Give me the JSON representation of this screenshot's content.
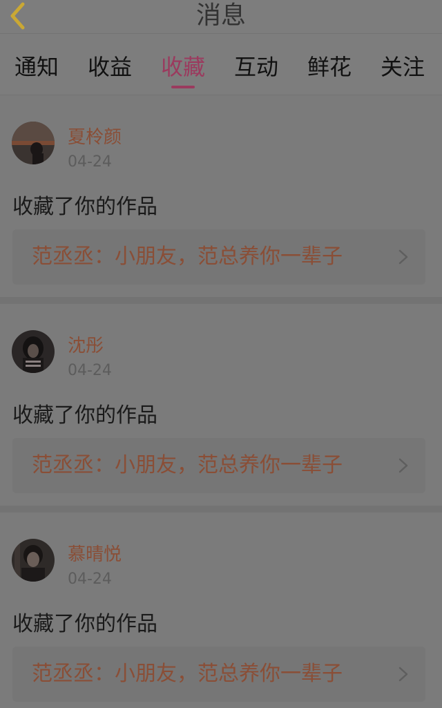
{
  "header": {
    "title": "消息",
    "back_icon": "chevron-left-icon"
  },
  "tabs": [
    {
      "label": "通知",
      "active": false
    },
    {
      "label": "收益",
      "active": false
    },
    {
      "label": "收藏",
      "active": true
    },
    {
      "label": "互动",
      "active": false
    },
    {
      "label": "鲜花",
      "active": false
    },
    {
      "label": "关注",
      "active": false
    }
  ],
  "colors": {
    "accent": "#9b3a5e",
    "name_color": "#8a4e36",
    "back_icon": "#caa834"
  },
  "messages": [
    {
      "user": "夏柃颜",
      "date": "04-24",
      "action": "收藏了你的作品",
      "work": "范丞丞：小朋友，范总养你一辈子"
    },
    {
      "user": "沈彤",
      "date": "04-24",
      "action": "收藏了你的作品",
      "work": "范丞丞：小朋友，范总养你一辈子"
    },
    {
      "user": "慕晴悦",
      "date": "04-24",
      "action": "收藏了你的作品",
      "work": "范丞丞：小朋友，范总养你一辈子"
    }
  ]
}
